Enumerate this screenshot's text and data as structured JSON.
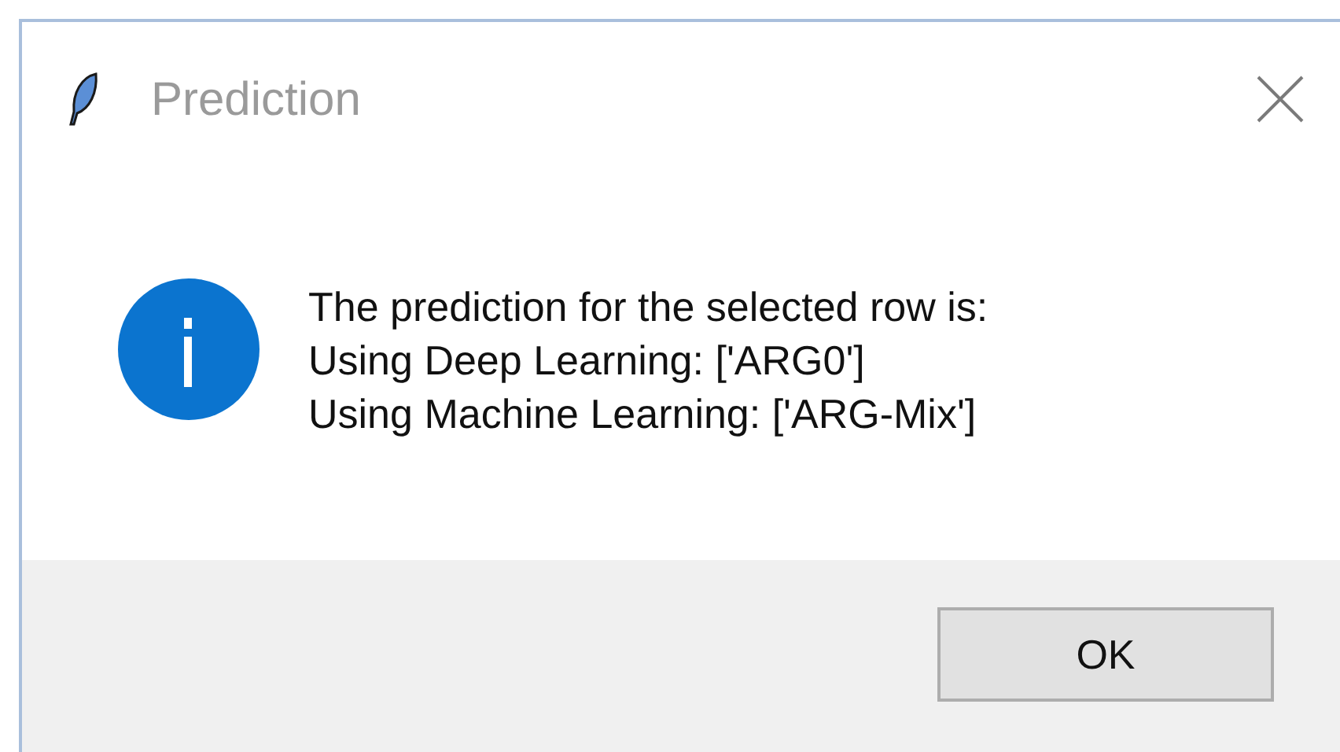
{
  "window": {
    "title": "Prediction"
  },
  "message": {
    "lines": [
      "The prediction for the selected row is:",
      "Using Deep Learning: ['ARG0']",
      "Using Machine Learning: ['ARG-Mix']"
    ]
  },
  "buttons": [
    "OK"
  ]
}
